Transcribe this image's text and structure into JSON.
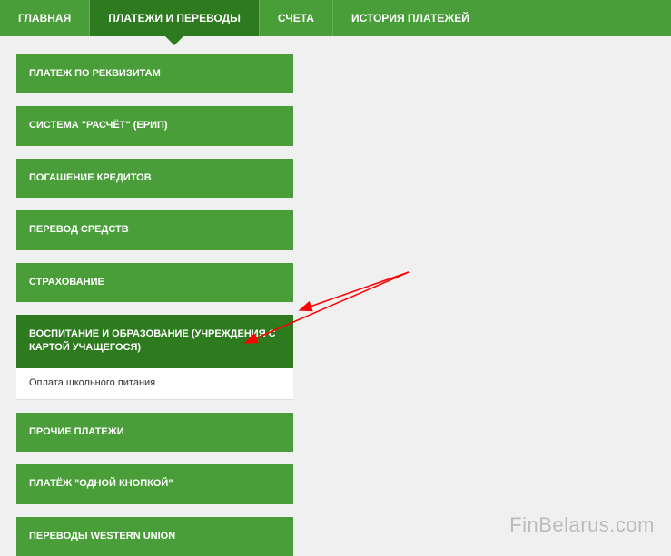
{
  "nav": {
    "tabs": [
      {
        "label": "ГЛАВНАЯ",
        "active": false
      },
      {
        "label": "ПЛАТЕЖИ И ПЕРЕВОДЫ",
        "active": true
      },
      {
        "label": "СЧЕТА",
        "active": false
      },
      {
        "label": "ИСТОРИЯ ПЛАТЕЖЕЙ",
        "active": false
      }
    ]
  },
  "menu": {
    "items": [
      {
        "label": "ПЛАТЕЖ ПО РЕКВИЗИТАМ"
      },
      {
        "label": "СИСТЕМА \"РАСЧЁТ\" (ЕРИП)"
      },
      {
        "label": "ПОГАШЕНИЕ КРЕДИТОВ"
      },
      {
        "label": "ПЕРЕВОД СРЕДСТВ"
      },
      {
        "label": "СТРАХОВАНИЕ"
      },
      {
        "label": "ВОСПИТАНИЕ И ОБРАЗОВАНИЕ (УЧРЕЖДЕНИЯ С КАРТОЙ УЧАЩЕГОСЯ)",
        "expanded": true
      },
      {
        "label": "ПРОЧИЕ ПЛАТЕЖИ"
      },
      {
        "label": "ПЛАТЁЖ \"ОДНОЙ КНОПКОЙ\""
      },
      {
        "label": "ПЕРЕВОДЫ WESTERN UNION"
      }
    ],
    "subItem": "Оплата школьного питания"
  },
  "watermark": "FinBelarus.com"
}
